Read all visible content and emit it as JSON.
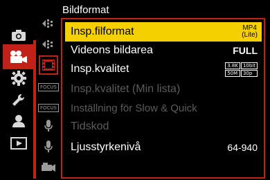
{
  "header": {
    "title": "Bildformat"
  },
  "colors": {
    "accent": "#c2211a",
    "highlight": "#f4d000",
    "disabled": "#5c5c5c"
  },
  "categories": [
    {
      "icon": "camera-icon",
      "selected": false
    },
    {
      "icon": "video-camera-icon",
      "selected": true
    },
    {
      "icon": "gear-icon",
      "selected": false
    },
    {
      "icon": "wrench-icon",
      "selected": false
    },
    {
      "icon": "person-icon",
      "selected": false
    },
    {
      "icon": "playback-icon",
      "selected": false
    }
  ],
  "tabs": [
    {
      "icon": "arrow-flow-icon",
      "text": ""
    },
    {
      "icon": "arrow-flow-icon",
      "text": ""
    },
    {
      "icon": "film-icon",
      "text": "",
      "selected": true
    },
    {
      "icon": "focus-icon",
      "text": "FOCUS"
    },
    {
      "icon": "focus-icon",
      "text": "FOCUS"
    },
    {
      "icon": "microphone-icon",
      "text": ""
    },
    {
      "icon": "microphone-icon",
      "text": ""
    },
    {
      "icon": "camcorder-icon",
      "text": ""
    }
  ],
  "menu": {
    "items": [
      {
        "label": "Insp.filformat",
        "value_top": "MP4",
        "value_bottom": "(Lite)"
      },
      {
        "label": "Videons bildarea",
        "value": "FULL"
      },
      {
        "label": "Insp.kvalitet",
        "badges": [
          "3.8K",
          "10bit",
          "50M",
          "30p"
        ]
      },
      {
        "label": "Insp.kvalitet (Min lista)"
      },
      {
        "label": "Inställning för Slow & Quick"
      },
      {
        "label": "Tidskod"
      },
      {
        "label": "Ljusstyrkenivå",
        "value": "64-940"
      }
    ]
  }
}
